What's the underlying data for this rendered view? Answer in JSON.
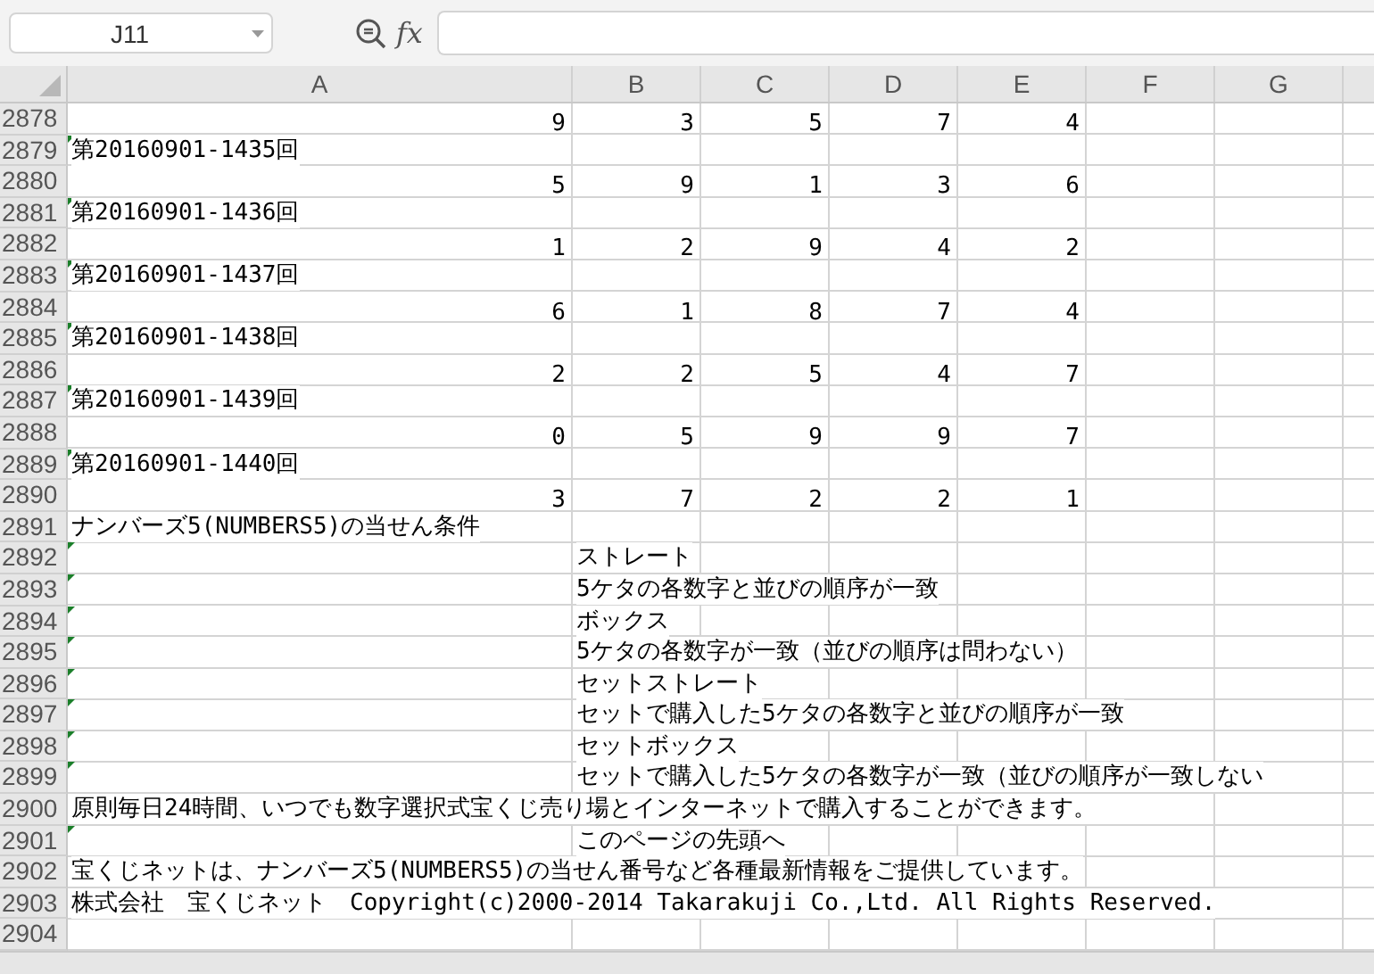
{
  "name_box": {
    "value": "J11"
  },
  "formula_bar": {
    "fx_label": "fx"
  },
  "columns": [
    "A",
    "B",
    "C",
    "D",
    "E",
    "F",
    "G"
  ],
  "rows": [
    {
      "number": "2878",
      "kind": "digits",
      "values": [
        "9",
        "3",
        "5",
        "7",
        "4"
      ]
    },
    {
      "number": "2879",
      "kind": "label",
      "text": "第20160901-1435回",
      "flagged": true
    },
    {
      "number": "2880",
      "kind": "digits",
      "values": [
        "5",
        "9",
        "1",
        "3",
        "6"
      ]
    },
    {
      "number": "2881",
      "kind": "label",
      "text": "第20160901-1436回",
      "flagged": true
    },
    {
      "number": "2882",
      "kind": "digits",
      "values": [
        "1",
        "2",
        "9",
        "4",
        "2"
      ]
    },
    {
      "number": "2883",
      "kind": "label",
      "text": "第20160901-1437回",
      "flagged": true
    },
    {
      "number": "2884",
      "kind": "digits",
      "values": [
        "6",
        "1",
        "8",
        "7",
        "4"
      ]
    },
    {
      "number": "2885",
      "kind": "label",
      "text": "第20160901-1438回",
      "flagged": true
    },
    {
      "number": "2886",
      "kind": "digits",
      "values": [
        "2",
        "2",
        "5",
        "4",
        "7"
      ]
    },
    {
      "number": "2887",
      "kind": "label",
      "text": "第20160901-1439回",
      "flagged": true
    },
    {
      "number": "2888",
      "kind": "digits",
      "values": [
        "0",
        "5",
        "9",
        "9",
        "7"
      ]
    },
    {
      "number": "2889",
      "kind": "label",
      "text": "第20160901-1440回",
      "flagged": true
    },
    {
      "number": "2890",
      "kind": "digits",
      "values": [
        "3",
        "7",
        "2",
        "2",
        "1"
      ]
    },
    {
      "number": "2891",
      "kind": "label",
      "text": "ナンバーズ5(NUMBERS5)の当せん条件",
      "flagged": false
    },
    {
      "number": "2892",
      "kind": "detail",
      "text": "ストレート",
      "flagged": true
    },
    {
      "number": "2893",
      "kind": "detail",
      "text": "5ケタの各数字と並びの順序が一致",
      "flagged": true
    },
    {
      "number": "2894",
      "kind": "detail",
      "text": "ボックス",
      "flagged": true
    },
    {
      "number": "2895",
      "kind": "detail",
      "text": "5ケタの各数字が一致（並びの順序は問わない）",
      "flagged": true
    },
    {
      "number": "2896",
      "kind": "detail",
      "text": "セットストレート",
      "flagged": true
    },
    {
      "number": "2897",
      "kind": "detail",
      "text": "セットで購入した5ケタの各数字と並びの順序が一致",
      "flagged": true
    },
    {
      "number": "2898",
      "kind": "detail",
      "text": "セットボックス",
      "flagged": true
    },
    {
      "number": "2899",
      "kind": "detail",
      "text": "セットで購入した5ケタの各数字が一致（並びの順序が一致しない",
      "flagged": true
    },
    {
      "number": "2900",
      "kind": "label",
      "text": "原則毎日24時間、いつでも数字選択式宝くじ売り場とインターネットで購入することができます。",
      "flagged": false
    },
    {
      "number": "2901",
      "kind": "detail",
      "text": "このページの先頭へ",
      "flagged": true
    },
    {
      "number": "2902",
      "kind": "label",
      "text": "宝くじネットは、ナンバーズ5(NUMBERS5)の当せん番号など各種最新情報をご提供しています。",
      "flagged": false
    },
    {
      "number": "2903",
      "kind": "label",
      "text": "株式会社　宝くじネット　Copyright(c)2000-2014 Takarakuji Co.,Ltd. All Rights Reserved.",
      "flagged": false
    },
    {
      "number": "2904",
      "kind": "empty"
    }
  ]
}
